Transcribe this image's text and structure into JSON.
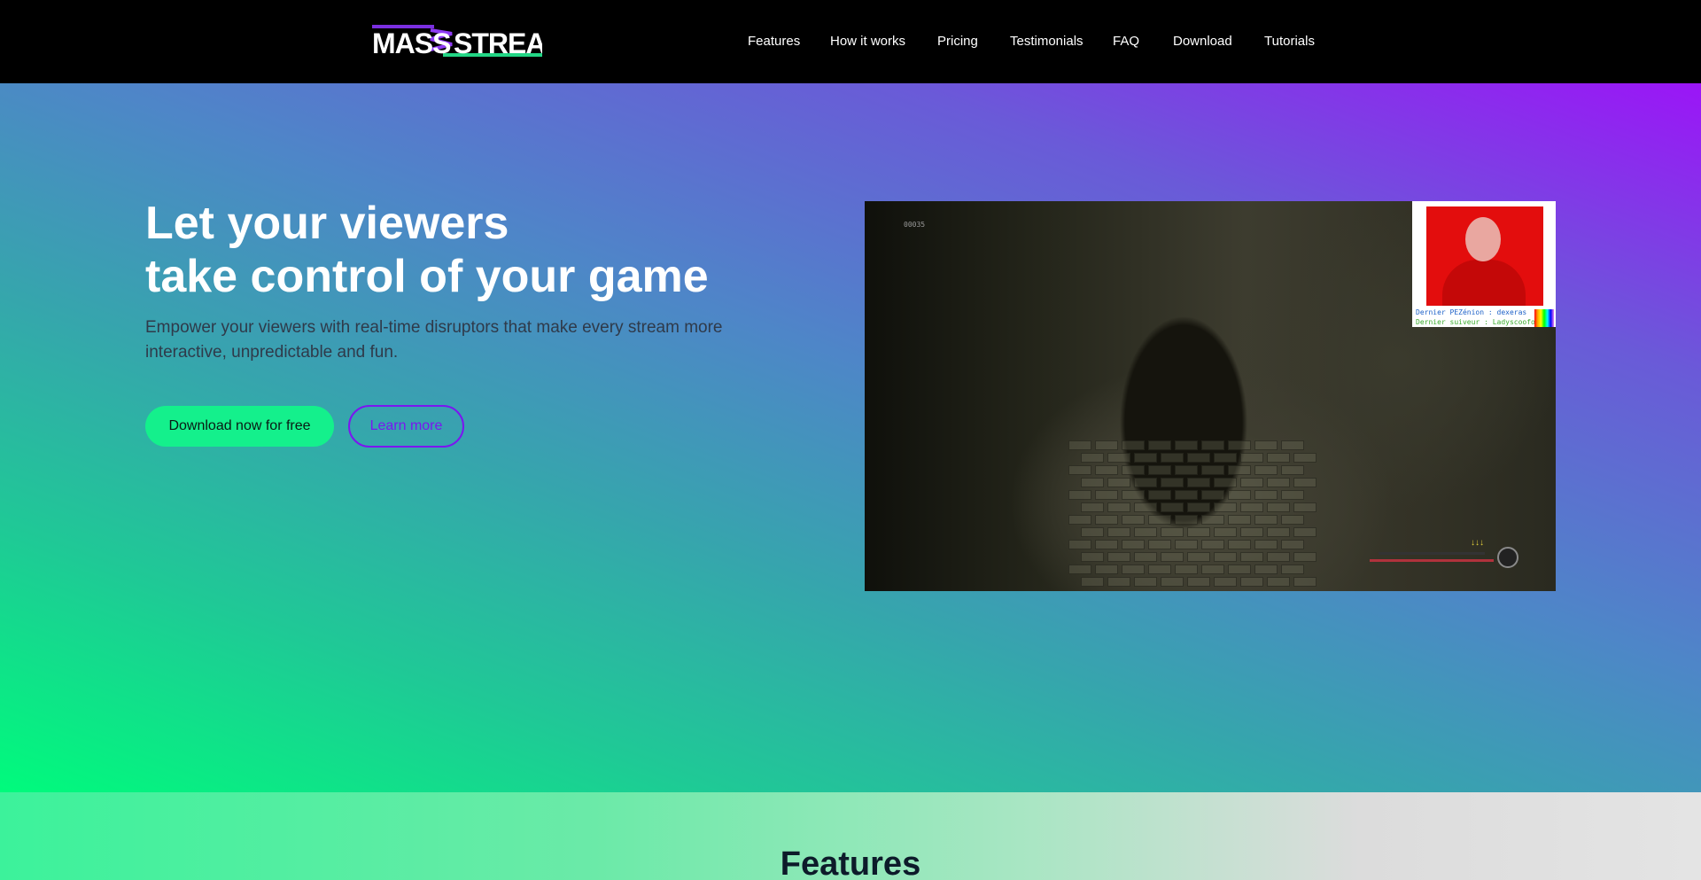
{
  "header": {
    "logo_alt": "MASS STREAM",
    "nav": [
      {
        "label": "Features"
      },
      {
        "label": "How it works"
      },
      {
        "label": "Pricing"
      },
      {
        "label": "Testimonials"
      },
      {
        "label": "FAQ"
      },
      {
        "label": "Download"
      },
      {
        "label": "Tutorials"
      }
    ]
  },
  "hero": {
    "title_line1": "Let your viewers",
    "title_line2": "take control of your game",
    "subtitle": "Empower your viewers with real-time disruptors that make every stream more interactive, unpredictable and fun.",
    "primary_button": "Download now for free",
    "secondary_button": "Learn more"
  },
  "video": {
    "hud_top": "00035",
    "overlay_line1": "Dernier PEZénion : dexeras",
    "overlay_line2": "Dernier suiveur : Ladyscoofo"
  },
  "features": {
    "title": "Features"
  },
  "colors": {
    "accent_green": "#14f08c",
    "accent_purple": "#7b16f0",
    "header_bg": "#000000"
  }
}
